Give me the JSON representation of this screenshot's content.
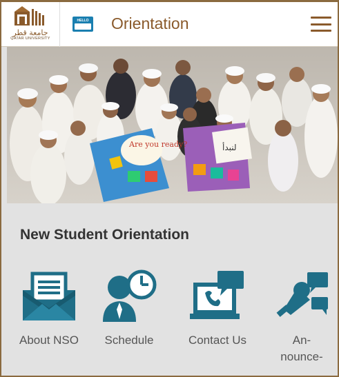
{
  "header": {
    "logo_arabic": "جامعة قطر",
    "logo_latin": "QATAR UNIVERSITY",
    "badge_text": "HELLO",
    "title": "Orientation"
  },
  "hero": {
    "sign_text_1": "Are you ready?",
    "sign_text_2": "لنبدأ"
  },
  "section": {
    "title": "New Student Orientation"
  },
  "tiles": [
    {
      "label": "About NSO",
      "icon": "envelope-icon"
    },
    {
      "label": "Schedule",
      "icon": "person-clock-icon"
    },
    {
      "label": "Contact Us",
      "icon": "laptop-chat-icon"
    },
    {
      "label": "An-\nnounce-",
      "icon": "megaphone-chat-icon"
    }
  ],
  "colors": {
    "accent_brown": "#8a5a2b",
    "icon_teal": "#1f6e87",
    "badge_blue": "#1a7fb0"
  }
}
